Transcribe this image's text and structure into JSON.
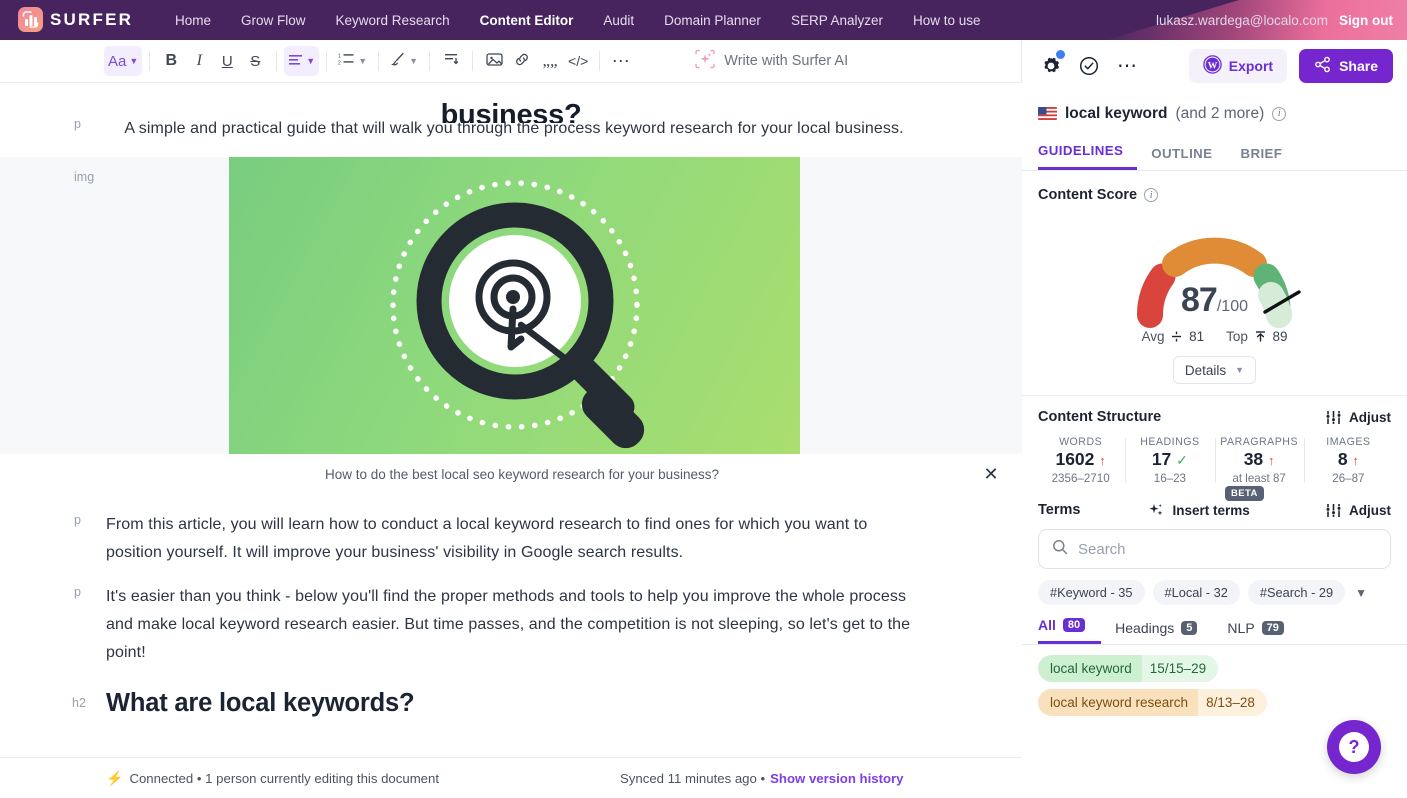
{
  "brand": {
    "name": "SURFER",
    "logo_icon": "bar-chart-logo"
  },
  "nav": {
    "links": [
      {
        "label": "Home",
        "active": false
      },
      {
        "label": "Grow Flow",
        "active": false
      },
      {
        "label": "Keyword Research",
        "active": false
      },
      {
        "label": "Content Editor",
        "active": true
      },
      {
        "label": "Audit",
        "active": false
      },
      {
        "label": "Domain Planner",
        "active": false
      },
      {
        "label": "SERP Analyzer",
        "active": false
      },
      {
        "label": "How to use",
        "active": false
      }
    ],
    "email": "lukasz.wardega@localo.com",
    "signout": "Sign out"
  },
  "toolbar": {
    "font_label": "Aa",
    "bold": "B",
    "italic": "I",
    "underline": "U",
    "strike": "S",
    "align_icon": "align-left-icon",
    "list_icon": "numbered-list-icon",
    "highlight_icon": "brush-icon",
    "indent_icon": "indent-icon",
    "image_icon": "image-icon",
    "link_icon": "link-icon",
    "quote_icon": "quote-icon",
    "code_icon": "code-icon",
    "more_icon": "ellipsis-icon",
    "ai_label": "Write with Surfer AI",
    "ai_icon": "sparkle-icon"
  },
  "document": {
    "clipped_heading": "business?",
    "blocks": [
      {
        "tag": "p",
        "align": "center",
        "text": "A simple and practical guide that will walk you through the process keyword research for your local business."
      }
    ],
    "image_gutter": "img",
    "image_caption": "How to do the best local seo keyword research for your business?",
    "image_close": "✕",
    "paragraphs": [
      {
        "tag": "p",
        "text": "From this article, you will learn how to conduct a local keyword research to find ones for which you want to position yourself. It will improve your business' visibility in Google search results."
      },
      {
        "tag": "p",
        "text": "It's easier than you think - below you'll find the proper methods and tools to help you improve the whole process and make local keyword research easier. But time passes, and the competition is not sleeping, so let's get to the point!"
      }
    ],
    "heading2": {
      "tag": "h2",
      "text": "What are local keywords?"
    }
  },
  "status": {
    "connected": "Connected • 1 person currently editing this document",
    "synced": "Synced 11 minutes ago •",
    "version_link": "Show version history",
    "bolt_icon": "lightning-icon"
  },
  "panel": {
    "gear_icon": "gear-icon",
    "check_icon": "check-circle-icon",
    "more_icon": "ellipsis-icon",
    "export_label": "Export",
    "export_icon": "wordpress-icon",
    "share_label": "Share",
    "share_icon": "share-icon",
    "keyword": "local keyword",
    "keyword_more": "(and 2 more)",
    "flag_icon": "us-flag-icon",
    "tabs": [
      {
        "label": "GUIDELINES",
        "active": true
      },
      {
        "label": "OUTLINE",
        "active": false
      },
      {
        "label": "BRIEF",
        "active": false
      }
    ],
    "content_score": {
      "title": "Content Score",
      "score": "87",
      "denominator": "/100",
      "avg_label": "Avg",
      "avg_value": "81",
      "top_label": "Top",
      "top_value": "89",
      "details_label": "Details",
      "needle_angle": 58
    },
    "structure": {
      "title": "Content Structure",
      "adjust_label": "Adjust",
      "adjust_icon": "sliders-icon",
      "stats": [
        {
          "label": "WORDS",
          "value": "1602",
          "flag": "up",
          "range": "2356–2710"
        },
        {
          "label": "HEADINGS",
          "value": "17",
          "flag": "ok",
          "range": "16–23"
        },
        {
          "label": "PARAGRAPHS",
          "value": "38",
          "flag": "up",
          "range": "at least 87"
        },
        {
          "label": "IMAGES",
          "value": "8",
          "flag": "up",
          "range": "26–87"
        }
      ]
    },
    "terms": {
      "title": "Terms",
      "insert_label": "Insert terms",
      "insert_icon": "sparkle-icon",
      "beta_badge": "BETA",
      "adjust_label": "Adjust",
      "search_placeholder": "Search",
      "search_value": "",
      "search_icon": "search-icon",
      "chips": [
        {
          "label": "#Keyword - 35"
        },
        {
          "label": "#Local - 32"
        },
        {
          "label": "#Search - 29"
        }
      ],
      "chips_more_icon": "chevron-down-icon",
      "tabs": [
        {
          "label": "All",
          "count": "80",
          "active": true
        },
        {
          "label": "Headings",
          "count": "5",
          "active": false
        },
        {
          "label": "NLP",
          "count": "79",
          "active": false
        }
      ],
      "list": [
        {
          "name": "local keyword",
          "count": "15/15–29",
          "color": "green"
        },
        {
          "name": "local keyword research",
          "count": "8/13–28",
          "color": "amber"
        }
      ]
    },
    "help_icon": "question-mark-icon"
  },
  "colors": {
    "brand_purple": "#7626ce",
    "nav_bg": "#48245f",
    "accent_pink": "#ec6f9b",
    "gauge_red": "#d9453c",
    "gauge_orange": "#e08b35",
    "gauge_green": "#5fb377",
    "gauge_light": "#d6ecd9"
  }
}
